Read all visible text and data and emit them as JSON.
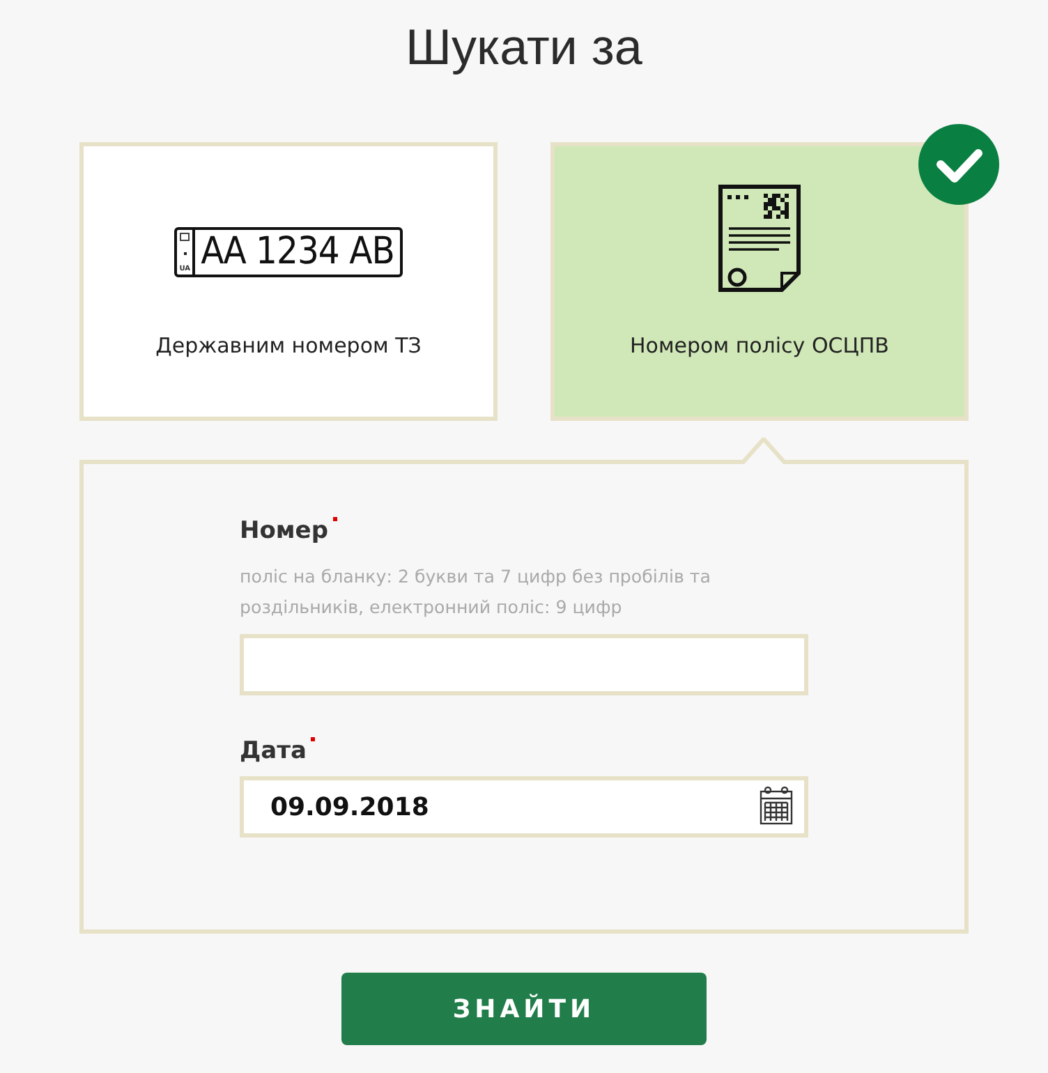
{
  "title": "Шукати за",
  "options": [
    {
      "kind": "plate",
      "label": "Державним номером ТЗ",
      "plate_text": "АА 1234 АВ",
      "plate_region": "UA",
      "selected": false
    },
    {
      "kind": "policy",
      "label": "Номером полісу ОСЦПВ",
      "selected": true
    }
  ],
  "fields": [
    {
      "kind": "text",
      "label": "Номер",
      "required": true,
      "hint": "поліс на бланку: 2 букви та 7 цифр без пробілів та роздільників, електронний поліс: 9 цифр"
    },
    {
      "kind": "date",
      "label": "Дата",
      "required": true,
      "value": "09.09.2018"
    }
  ],
  "submit": "ЗНАЙТИ"
}
